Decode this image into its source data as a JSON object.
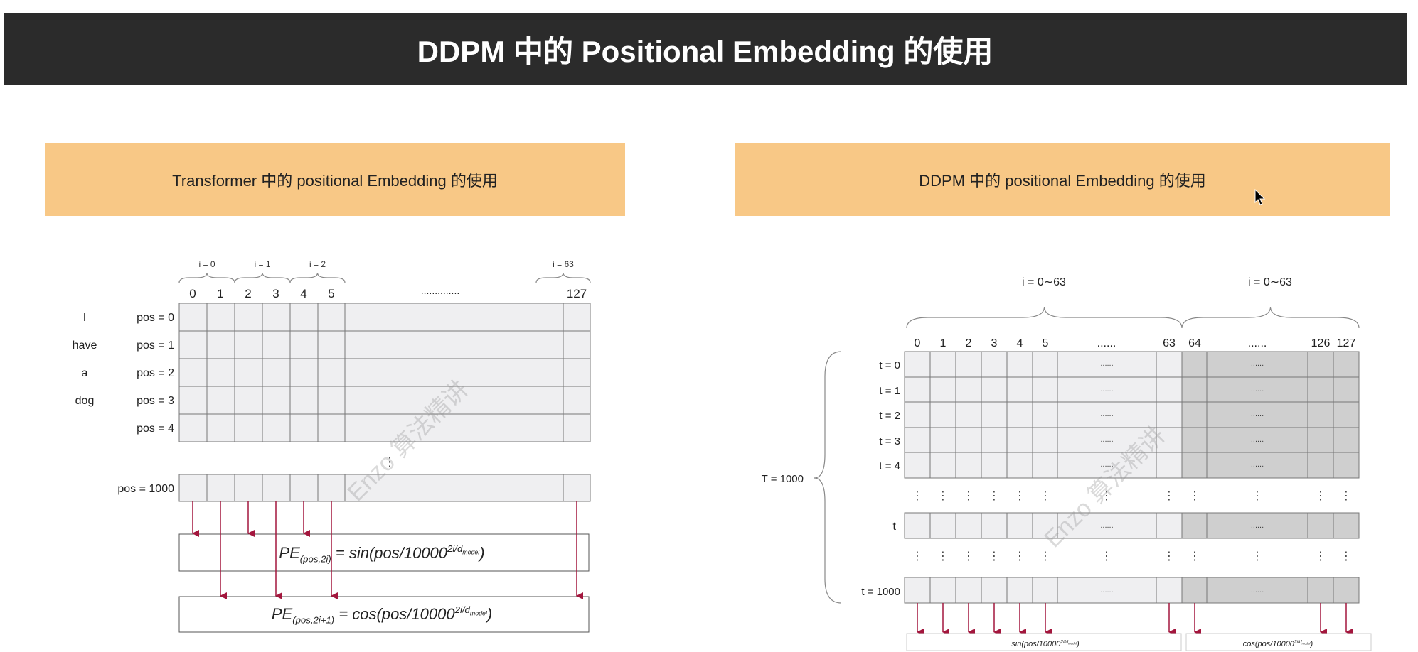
{
  "title": "DDPM 中的 Positional Embedding 的使用",
  "left_panel": {
    "header": "Transformer 中的 positional Embedding 的使用",
    "brace_labels": [
      "i = 0",
      "i = 1",
      "i = 2",
      "i = 63"
    ],
    "column_labels": [
      "0",
      "1",
      "2",
      "3",
      "4",
      "5",
      "127"
    ],
    "column_ellipsis": "..............",
    "words": [
      "I",
      "have",
      "a",
      "dog"
    ],
    "row_labels": [
      "pos = 0",
      "pos = 1",
      "pos = 2",
      "pos = 3",
      "pos = 4"
    ],
    "vertical_ellipsis": "⋮",
    "last_row_label": "pos = 1000",
    "formula_sin": {
      "prefix": "PE",
      "sub": "(pos,2i)",
      "rhs": " = sin(pos/10000",
      "sup": "2i/d",
      "supsub": "model",
      "tail": ")"
    },
    "formula_cos": {
      "prefix": "PE",
      "sub": "(pos,2i+1)",
      "rhs": " = cos(pos/10000",
      "sup": "2i/d",
      "supsub": "model",
      "tail": ")"
    }
  },
  "right_panel": {
    "header": "DDPM 中的 positional Embedding 的使用",
    "brace_labels": [
      "i = 0∼63",
      "i = 0∼63"
    ],
    "column_labels": [
      "0",
      "1",
      "2",
      "3",
      "4",
      "5",
      "......",
      "63",
      "64",
      "......",
      "126",
      "127"
    ],
    "row_labels": [
      "t = 0",
      "t = 1",
      "t = 2",
      "t = 3",
      "t = 4"
    ],
    "mid_row_label": "t",
    "last_row_label": "t = 1000",
    "total_label": "T = 1000",
    "cell_ellipsis": "......",
    "vertical_ellipsis": "⋮",
    "formula_sin": "sin(pos/10000",
    "formula_cos": "cos(pos/10000",
    "formula_sup": "2i/d",
    "formula_supsub": "model",
    "formula_tail": ")"
  },
  "watermark": "Enzo 算法精讲",
  "colors": {
    "title_bg": "#2b2b2b",
    "header_bg": "#f8c886",
    "grid_light": "#efeff1",
    "grid_dark": "#cfcfcf",
    "arrow": "#a3163d"
  }
}
